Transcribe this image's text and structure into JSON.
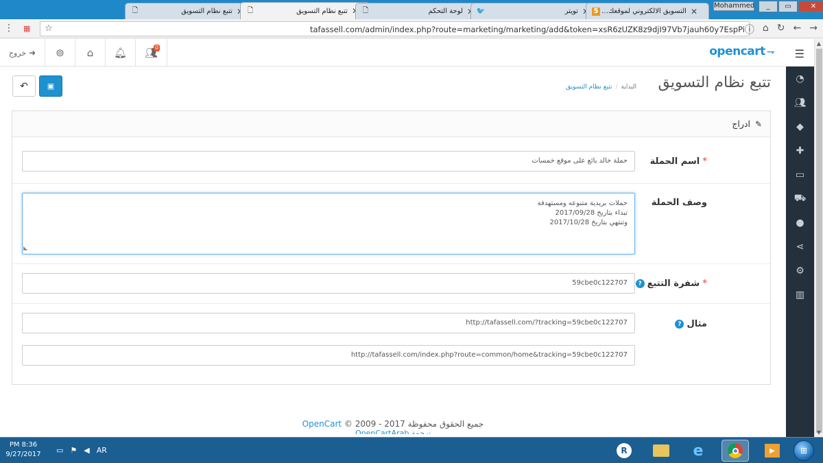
{
  "browser": {
    "tabs": [
      {
        "title": "تتبع نظام التسويق",
        "icon": "document-icon",
        "active": false
      },
      {
        "title": "تتبع نظام التسويق",
        "icon": "document-icon",
        "active": true
      },
      {
        "title": "لوحة التحكم",
        "icon": "document-icon",
        "active": false
      },
      {
        "title": "تويتر",
        "icon": "twitter-icon",
        "active": false
      },
      {
        "title": "التسويق الالكتروني لموقعك او لمـ",
        "icon": "site-favicon",
        "active": false
      }
    ],
    "user_name": "Mohammed",
    "url": "tafassell.com/admin/index.php?route=marketing/marketing/add&token=xsR6zUZK8z9djI97Vb7jauh60y7EspPi"
  },
  "header": {
    "logout_label": "خروج",
    "notification_count": "0",
    "logo_text": "opencart",
    "logo_cart": "⇁"
  },
  "page": {
    "title": "تتبع نظام التسويق",
    "breadcrumb": [
      "البداية",
      "تتبع نظام التسويق"
    ]
  },
  "panel": {
    "title": "ادراج"
  },
  "form": {
    "name": {
      "label": "اسم الحملة",
      "value": "حملة خالد بائع على موقع خمسات"
    },
    "description": {
      "label": "وصف الحملة",
      "lines": [
        "حملات بريدية متنوعه ومستهدفة",
        "تبداء بتاريخ 2017/09/28",
        "وتنتهي بتاريخ 2017/10/28"
      ]
    },
    "tracking_code": {
      "label": "شفرة التتبع",
      "value": "59cbe0c122707"
    },
    "example": {
      "label": "مثال",
      "value1": "http://tafassell.com/?tracking=59cbe0c122707",
      "value2": "http://tafassell.com/index.php?route=common/home&tracking=59cbe0c122707"
    }
  },
  "footer": {
    "rights": "جميع الحقوق محفوظة",
    "copyright": "© 2009 - 2017",
    "brand": "OpenCart",
    "translation": "ترجمة OpenCartArab"
  },
  "taskbar": {
    "time": "PM 8:36",
    "date": "9/27/2017",
    "language": "AR"
  }
}
